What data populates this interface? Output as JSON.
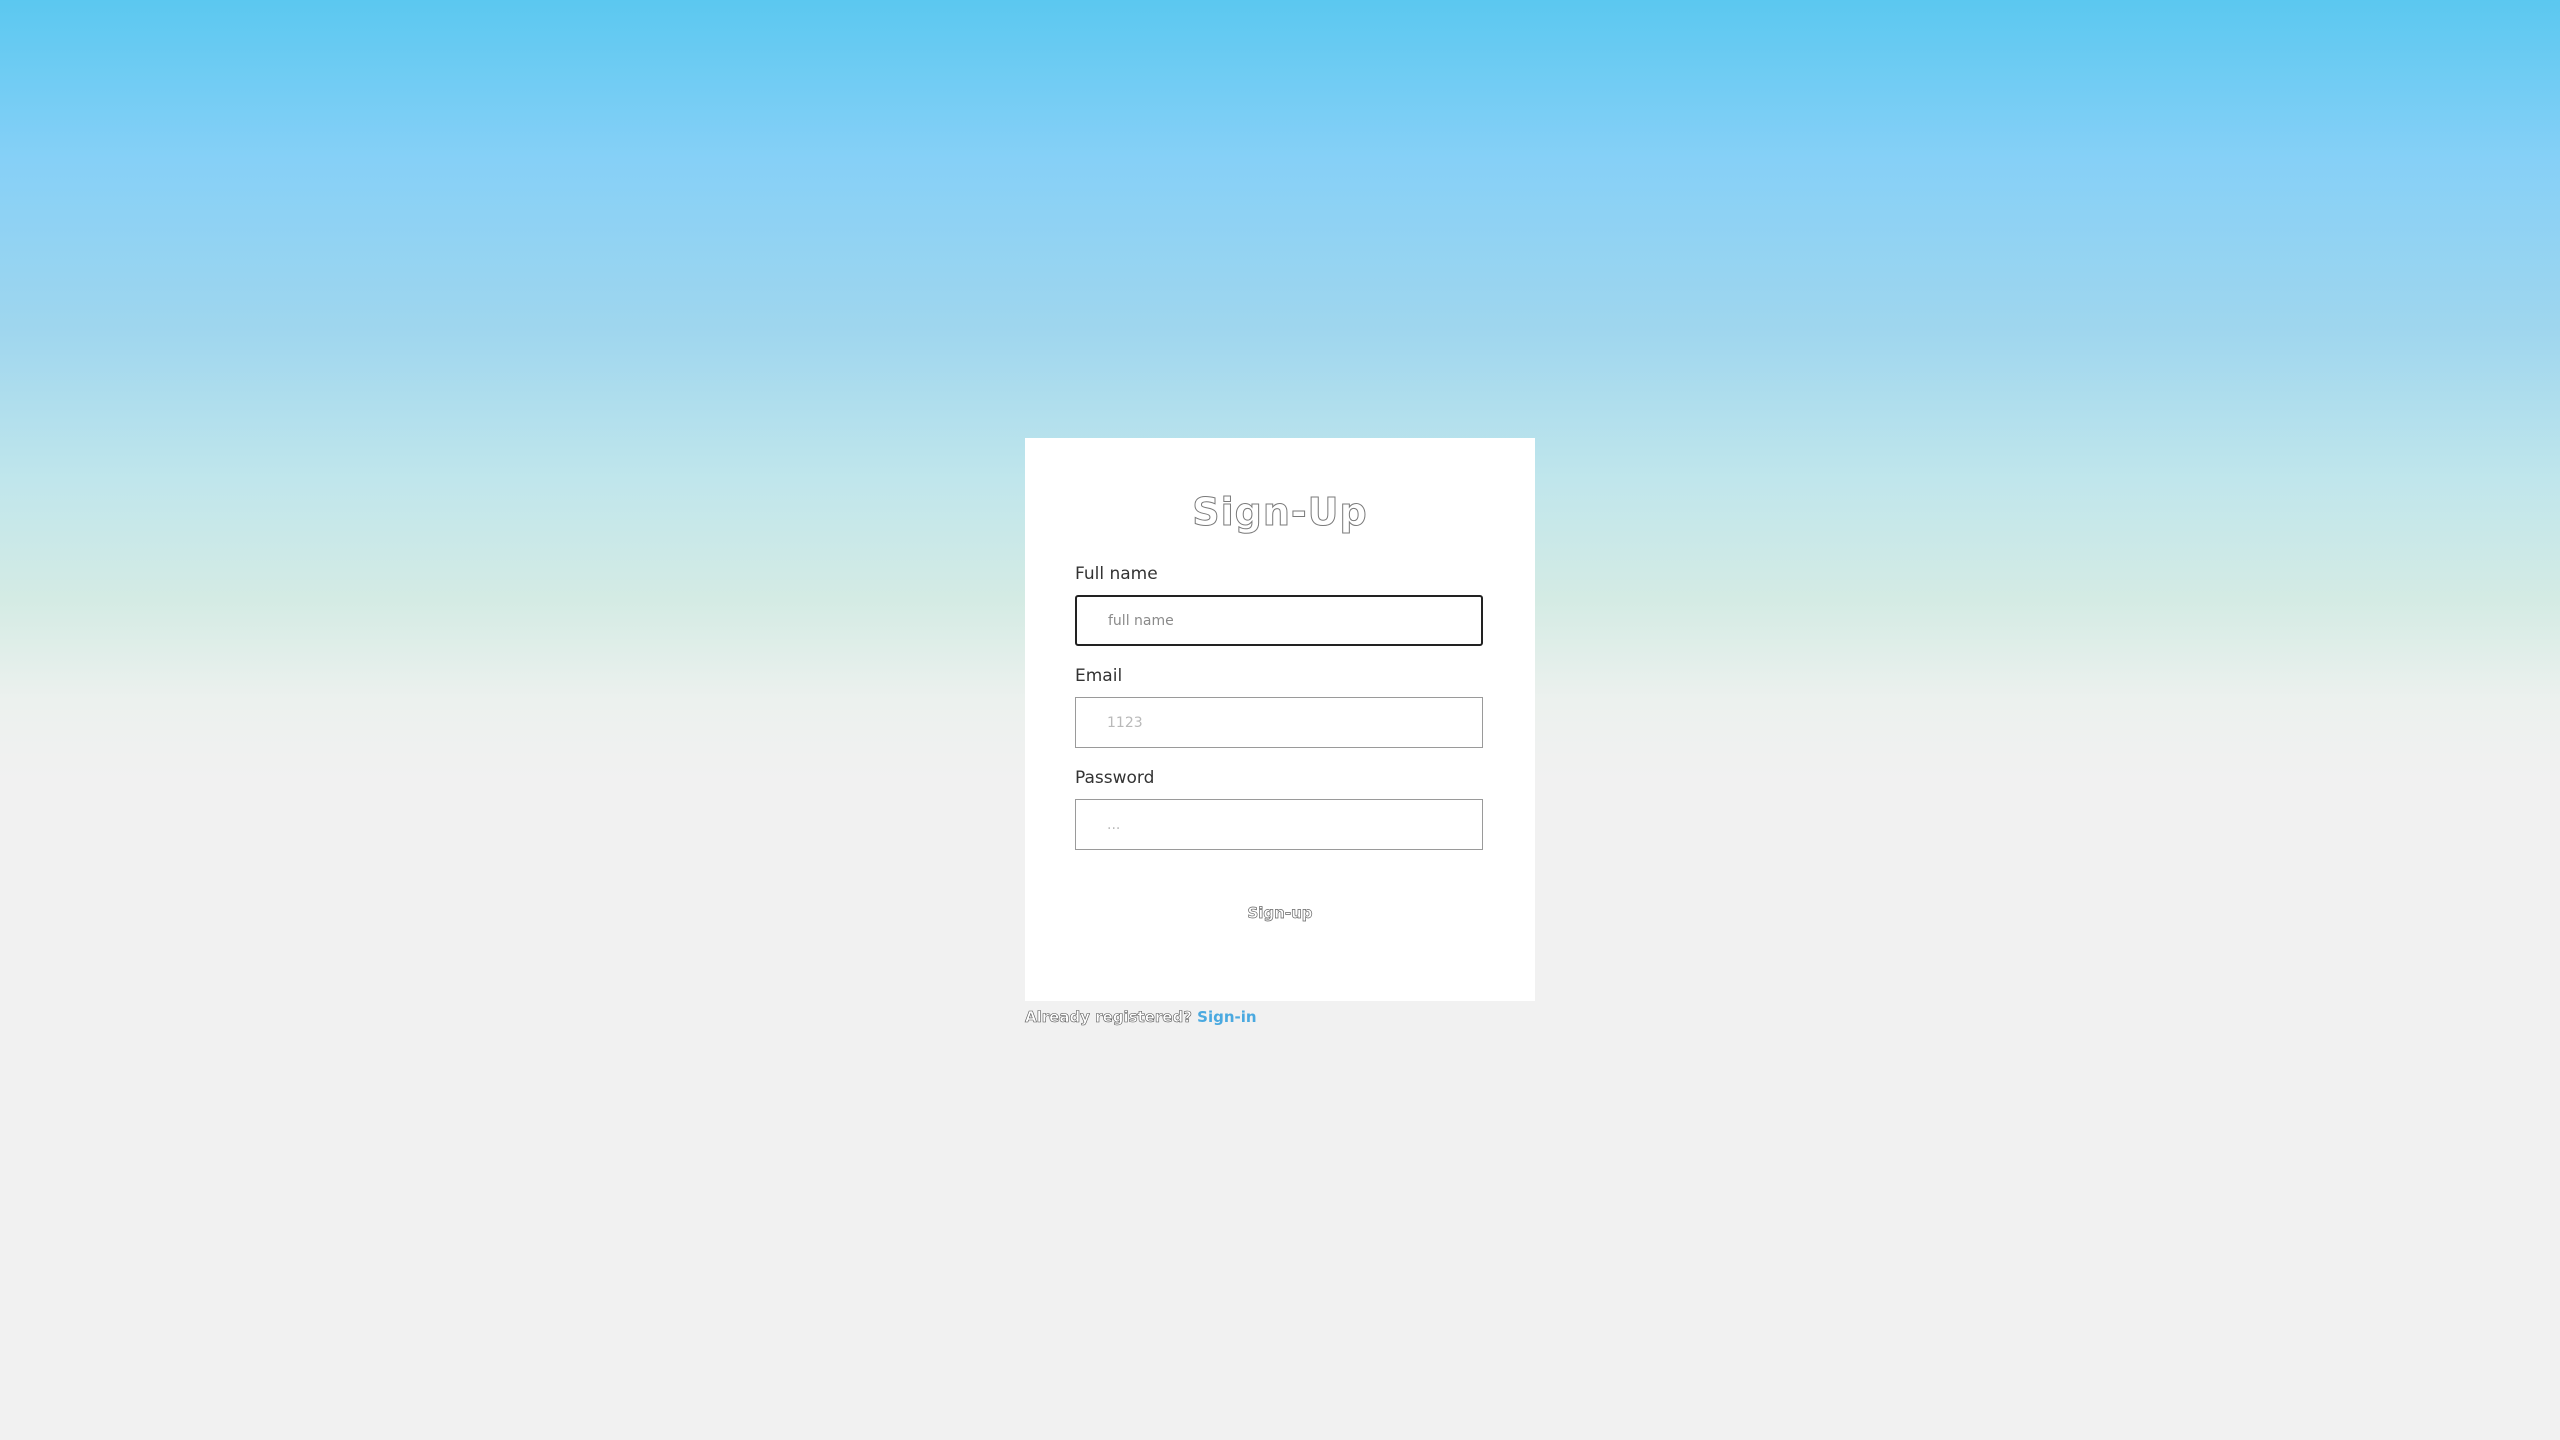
{
  "form": {
    "title": "Sign-Up",
    "fields": [
      {
        "label": "Full name",
        "placeholder": "full name",
        "value": ""
      },
      {
        "label": "Email",
        "placeholder": "1123",
        "value": ""
      },
      {
        "label": "Password",
        "placeholder": "...",
        "value": ""
      }
    ],
    "submit_label": "Sign-up"
  },
  "footer": {
    "prompt": "Already registered?",
    "link_label": "Sign-in"
  },
  "colors": {
    "link": "#4aa9e0",
    "gradient_top": "#5bc8f0",
    "page_background": "#f1f1f1",
    "card": "#ffffff"
  }
}
